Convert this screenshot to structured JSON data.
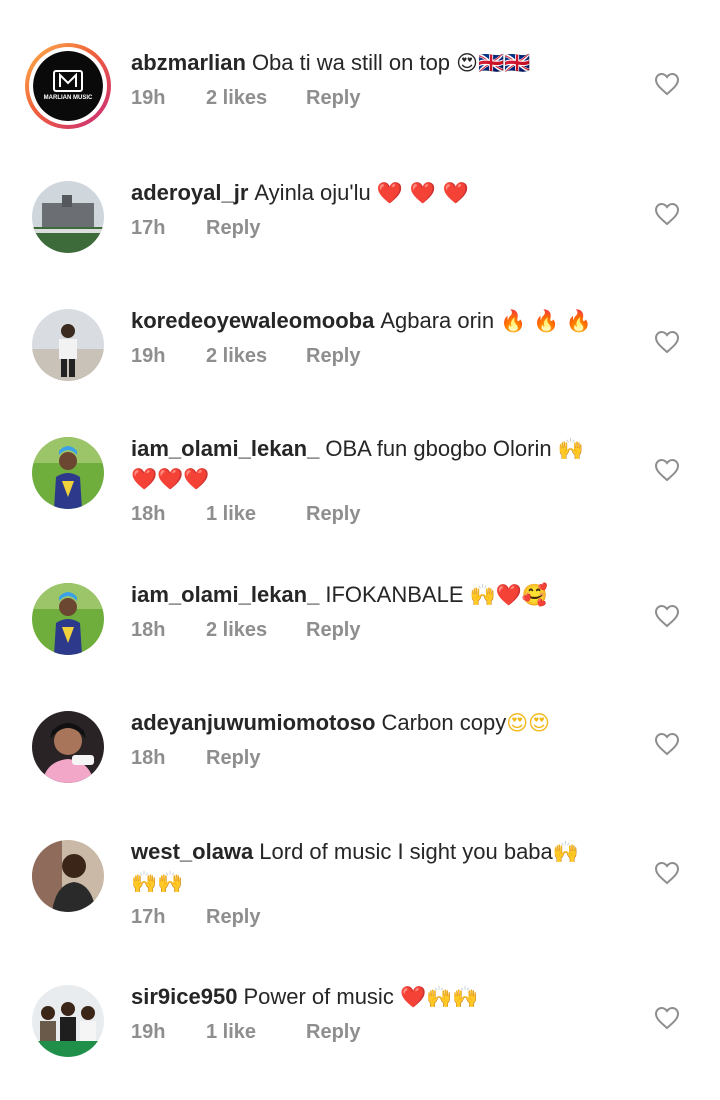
{
  "comments": [
    {
      "username": "abzmarlian",
      "text": "Oba ti wa still on top",
      "emoji": "😍🇬🇧🇬🇧",
      "time": "19h",
      "likes": "2 likes",
      "reply": "Reply",
      "avatar": "marlian-music-logo",
      "avatar_label": "MARLIAN MUSIC"
    },
    {
      "username": "aderoyal_jr",
      "text": "Ayinla oju'lu",
      "emoji": "❤️ ❤️ ❤️",
      "time": "17h",
      "likes": "",
      "reply": "Reply",
      "avatar": "building-photo"
    },
    {
      "username": "koredeoyewaleomooba",
      "text": "Agbara orin",
      "emoji": "🔥 🔥 🔥",
      "time": "19h",
      "likes": "2 likes",
      "reply": "Reply",
      "avatar": "person-beach-photo"
    },
    {
      "username": "iam_olami_lekan_",
      "text": "OBA fun gbogbo Olorin",
      "emoji": "🙌",
      "emoji_line2": "❤️❤️❤️",
      "time": "18h",
      "likes": "1 like",
      "reply": "Reply",
      "avatar": "person-green-photo"
    },
    {
      "username": "iam_olami_lekan_",
      "text": "IFOKANBALE",
      "emoji": "🙌❤️🥰",
      "time": "18h",
      "likes": "2 likes",
      "reply": "Reply",
      "avatar": "person-green-photo"
    },
    {
      "username": "adeyanjuwumiomotoso",
      "text": "Carbon copy",
      "emoji": "😍😍",
      "time": "18h",
      "likes": "",
      "reply": "Reply",
      "avatar": "person-pink-photo"
    },
    {
      "username": "west_olawa",
      "text": "Lord of music I sight you baba",
      "emoji": "🙌",
      "emoji_line2": "🙌🙌",
      "time": "17h",
      "likes": "",
      "reply": "Reply",
      "avatar": "person-field-photo"
    },
    {
      "username": "sir9ice950",
      "text": "Power of music",
      "emoji": "❤️🙌🙌",
      "time": "19h",
      "likes": "1 like",
      "reply": "Reply",
      "avatar": "group-photo"
    }
  ],
  "colors": {
    "text": "#262626",
    "meta": "#8e8e8e",
    "heart_outline": "#8e8e8e"
  },
  "icons": {
    "like": "heart-outline-icon"
  }
}
